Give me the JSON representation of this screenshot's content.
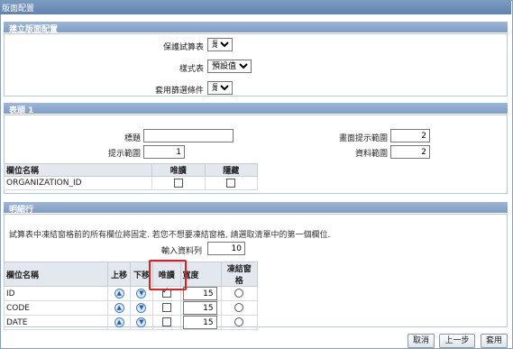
{
  "window": {
    "title": "版面配置"
  },
  "layout_section": {
    "header": "建立版面配置",
    "fields": [
      {
        "label": "保護試算表",
        "value": "是"
      },
      {
        "label": "樣式表",
        "value": "預設值"
      },
      {
        "label": "套用篩選條件",
        "value": "是"
      }
    ]
  },
  "header_section": {
    "header": "表頭 1",
    "title_label": "標題",
    "title_value": "",
    "prompt_range_label": "提示範圍",
    "prompt_range_value": "1",
    "page_prompt_range_label": "畫面提示範圍",
    "page_prompt_range_value": "2",
    "data_range_label": "資料範圍",
    "data_range_value": "2",
    "table": {
      "columns": [
        "欄位名稱",
        "唯讀",
        "隱藏"
      ],
      "rows": [
        {
          "name": "ORGANIZATION_ID",
          "readonly": false,
          "hidden": false
        }
      ]
    }
  },
  "detail_section": {
    "header": "明細行",
    "description": "試算表中凍結窗格前的所有欄位將固定. 若您不想要凍結窗格, 請選取清單中的第一個欄位.",
    "input_rows_label": "輸入資料列",
    "input_rows_value": "10",
    "table": {
      "columns": [
        "欄位名稱",
        "上移",
        "下移",
        "唯讀",
        "寬度",
        "凍結窗格"
      ],
      "rows": [
        {
          "name": "ID",
          "readonly": true,
          "width": "15"
        },
        {
          "name": "CODE",
          "readonly": false,
          "width": "15"
        },
        {
          "name": "DATE",
          "readonly": false,
          "width": "15"
        }
      ]
    }
  },
  "buttons": {
    "cancel": "取消",
    "back": "上一步",
    "apply": "套用"
  },
  "colors": {
    "title_bar": "#5f82b0",
    "section_header": "#7f9dc6",
    "highlight": "#e02020"
  }
}
